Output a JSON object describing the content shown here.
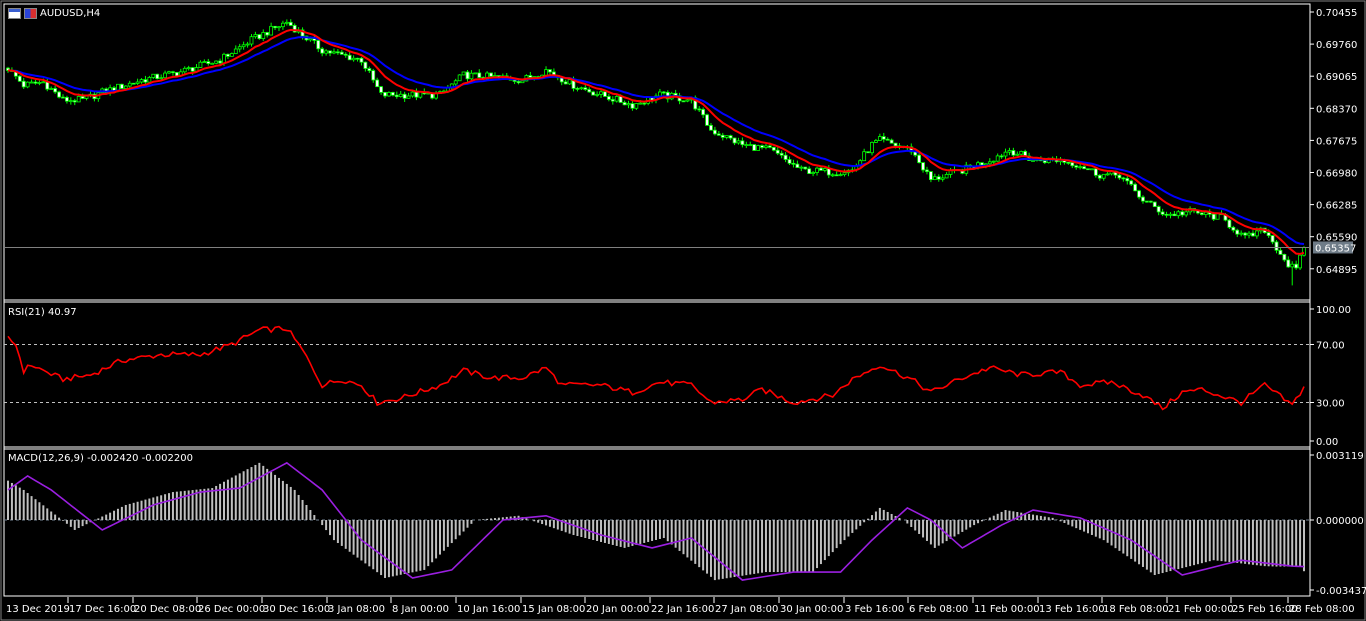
{
  "window": {
    "symbol_title": "AUDUSD,H4"
  },
  "icons": [
    "chart-window-icon",
    "expert-advisor-icon"
  ],
  "colors": {
    "bull": "#00ff00",
    "bear_body": "#ffffff",
    "ma_fast": "#ff0000",
    "ma_slow": "#0000ff",
    "rsi": "#ff0000",
    "macd_signal": "#9a1fe0",
    "macd_hist": "#c0c0c0",
    "price_label_bg": "#6e7b87"
  },
  "price_axis": {
    "labels": [
      "0.70455",
      "0.69760",
      "0.69065",
      "0.68370",
      "0.67675",
      "0.66980",
      "0.66285",
      "0.65590",
      "0.64895"
    ],
    "current_price": "0.65357"
  },
  "rsi": {
    "title": "RSI(21) 40.97",
    "labels": [
      "100.00",
      "70.00",
      "30.00",
      "0.00"
    ]
  },
  "macd": {
    "title": "MACD(12,26,9) -0.002420 -0.002200",
    "labels": [
      "0.003119",
      "0.000000",
      "-0.003437"
    ]
  },
  "time_axis": {
    "labels": [
      "13 Dec 2019",
      "17 Dec 16:00",
      "20 Dec 08:00",
      "26 Dec 00:00",
      "30 Dec 16:00",
      "3 Jan 08:00",
      "8 Jan 00:00",
      "10 Jan 16:00",
      "15 Jan 08:00",
      "20 Jan 00:00",
      "22 Jan 16:00",
      "27 Jan 08:00",
      "30 Jan 00:00",
      "3 Feb 16:00",
      "6 Feb 08:00",
      "11 Feb 00:00",
      "13 Feb 16:00",
      "18 Feb 08:00",
      "21 Feb 00:00",
      "25 Feb 16:00",
      "28 Feb 08:00"
    ]
  },
  "chart_data": {
    "type": "candlestick",
    "symbol": "AUDUSD",
    "timeframe": "H4",
    "bars": 331,
    "price_range": [
      0.646,
      0.705
    ],
    "close_keypoints": [
      [
        0,
        0.6924
      ],
      [
        4,
        0.6887
      ],
      [
        9,
        0.6894
      ],
      [
        14,
        0.6855
      ],
      [
        19,
        0.6855
      ],
      [
        24,
        0.6872
      ],
      [
        34,
        0.6898
      ],
      [
        44,
        0.6916
      ],
      [
        54,
        0.6942
      ],
      [
        62,
        0.6985
      ],
      [
        71,
        0.7024
      ],
      [
        75,
        0.6996
      ],
      [
        80,
        0.6963
      ],
      [
        85,
        0.6952
      ],
      [
        90,
        0.6942
      ],
      [
        95,
        0.6866
      ],
      [
        103,
        0.6866
      ],
      [
        110,
        0.6866
      ],
      [
        116,
        0.6909
      ],
      [
        126,
        0.6903
      ],
      [
        131,
        0.6898
      ],
      [
        137,
        0.692
      ],
      [
        144,
        0.6887
      ],
      [
        151,
        0.6866
      ],
      [
        159,
        0.6844
      ],
      [
        166,
        0.6866
      ],
      [
        174,
        0.6855
      ],
      [
        179,
        0.679
      ],
      [
        187,
        0.6758
      ],
      [
        194,
        0.6747
      ],
      [
        202,
        0.6703
      ],
      [
        210,
        0.6699
      ],
      [
        215,
        0.6703
      ],
      [
        220,
        0.6758
      ],
      [
        222,
        0.6768
      ],
      [
        230,
        0.6747
      ],
      [
        235,
        0.6682
      ],
      [
        243,
        0.6703
      ],
      [
        250,
        0.6725
      ],
      [
        255,
        0.6747
      ],
      [
        261,
        0.6725
      ],
      [
        268,
        0.6725
      ],
      [
        273,
        0.6714
      ],
      [
        278,
        0.6693
      ],
      [
        283,
        0.6693
      ],
      [
        289,
        0.6639
      ],
      [
        295,
        0.6606
      ],
      [
        301,
        0.6613
      ],
      [
        309,
        0.66
      ],
      [
        315,
        0.6556
      ],
      [
        320,
        0.6574
      ],
      [
        326,
        0.6498
      ],
      [
        328,
        0.6487
      ],
      [
        330,
        0.65357
      ]
    ],
    "rsi_range": [
      0,
      100
    ],
    "rsi_levels": [
      30,
      70
    ],
    "rsi_keypoints": [
      [
        0,
        74
      ],
      [
        2,
        70
      ],
      [
        4,
        52
      ],
      [
        6,
        56
      ],
      [
        9,
        52
      ],
      [
        14,
        46
      ],
      [
        21,
        49
      ],
      [
        29,
        59
      ],
      [
        39,
        63
      ],
      [
        49,
        63
      ],
      [
        57,
        70
      ],
      [
        64,
        80
      ],
      [
        71,
        81
      ],
      [
        75,
        66
      ],
      [
        80,
        42
      ],
      [
        85,
        46
      ],
      [
        90,
        42
      ],
      [
        94,
        30
      ],
      [
        100,
        33
      ],
      [
        110,
        42
      ],
      [
        116,
        52
      ],
      [
        123,
        47
      ],
      [
        131,
        47
      ],
      [
        137,
        54
      ],
      [
        141,
        42
      ],
      [
        151,
        42
      ],
      [
        159,
        37
      ],
      [
        166,
        44
      ],
      [
        174,
        42
      ],
      [
        179,
        30
      ],
      [
        187,
        32
      ],
      [
        192,
        39
      ],
      [
        200,
        30
      ],
      [
        210,
        35
      ],
      [
        215,
        46
      ],
      [
        222,
        56
      ],
      [
        230,
        46
      ],
      [
        235,
        37
      ],
      [
        243,
        47
      ],
      [
        250,
        54
      ],
      [
        258,
        49
      ],
      [
        268,
        51
      ],
      [
        273,
        42
      ],
      [
        281,
        44
      ],
      [
        289,
        35
      ],
      [
        294,
        26
      ],
      [
        299,
        37
      ],
      [
        304,
        39
      ],
      [
        314,
        30
      ],
      [
        320,
        42
      ],
      [
        327,
        28
      ],
      [
        330,
        40.97
      ]
    ],
    "macd_range": [
      -0.003437,
      0.003119
    ],
    "macd_signal_keypoints": [
      [
        0,
        0.00142
      ],
      [
        5,
        0.00208
      ],
      [
        11,
        0.00142
      ],
      [
        24,
        -0.00047
      ],
      [
        37,
        0.00071
      ],
      [
        49,
        0.00132
      ],
      [
        59,
        0.00151
      ],
      [
        71,
        0.0027
      ],
      [
        80,
        0.00142
      ],
      [
        90,
        -0.00095
      ],
      [
        103,
        -0.00274
      ],
      [
        113,
        -0.00236
      ],
      [
        126,
        0
      ],
      [
        137,
        0.0002
      ],
      [
        151,
        -0.00071
      ],
      [
        164,
        -0.00132
      ],
      [
        174,
        -0.00085
      ],
      [
        187,
        -0.00284
      ],
      [
        200,
        -0.00246
      ],
      [
        212,
        -0.00246
      ],
      [
        220,
        -0.00095
      ],
      [
        229,
        0.00057
      ],
      [
        235,
        0
      ],
      [
        243,
        -0.00132
      ],
      [
        253,
        -0.00024
      ],
      [
        261,
        0.00047
      ],
      [
        273,
        0.0001
      ],
      [
        286,
        -0.00095
      ],
      [
        299,
        -0.0026
      ],
      [
        314,
        -0.0019
      ],
      [
        327,
        -0.00218
      ],
      [
        330,
        -0.0022
      ]
    ],
    "macd_last": -0.00242
  }
}
